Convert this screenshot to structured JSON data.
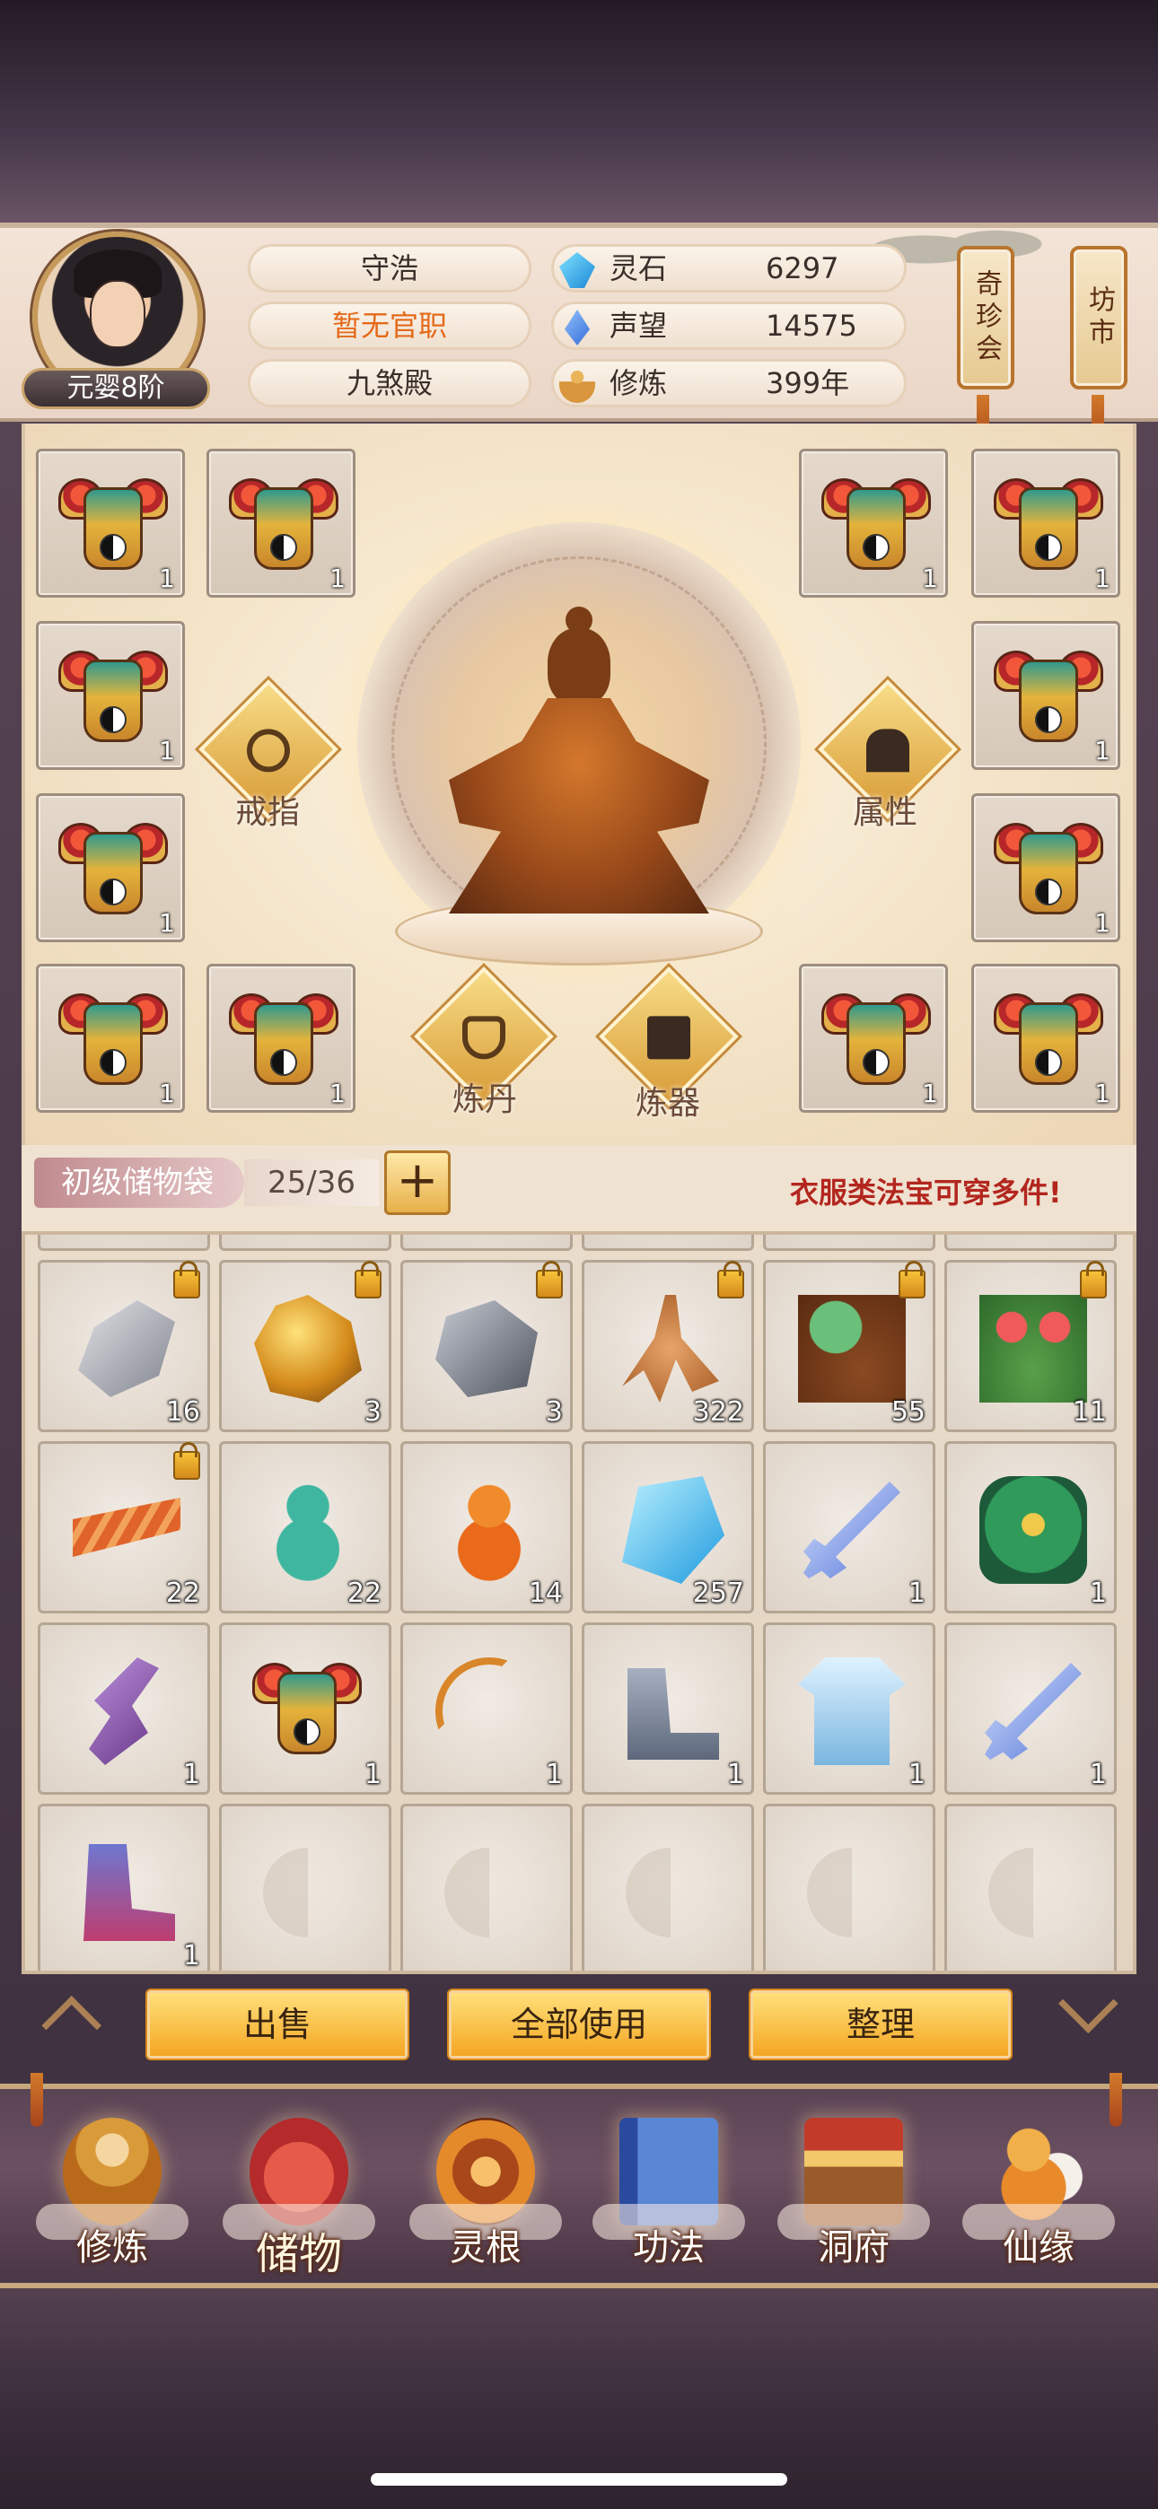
{
  "player": {
    "realm": "元婴8阶",
    "name": "守浩",
    "title": "暂无官职",
    "sect": "九煞殿"
  },
  "stats": [
    {
      "label": "灵石",
      "value": "6297",
      "icon": "spirit-stone-icon"
    },
    {
      "label": "声望",
      "value": "14575",
      "icon": "prestige-icon"
    },
    {
      "label": "修炼",
      "value": "399年",
      "icon": "cultivation-icon"
    }
  ],
  "shops": {
    "treasure": "奇珍会",
    "market": "坊市"
  },
  "equipment": {
    "left_slots": [
      "1",
      "1",
      "1",
      "1",
      "1",
      "1"
    ],
    "right_slots": [
      "1",
      "1",
      "1",
      "1",
      "1",
      "1"
    ],
    "ring_label": "戒指",
    "attr_label": "属性",
    "alchemy_label": "炼丹",
    "forge_label": "炼器"
  },
  "storage": {
    "bag_name": "初级储物袋",
    "capacity": "25/36",
    "expand": "+",
    "tip": "衣服类法宝可穿多件!"
  },
  "inventory": [
    {
      "name": "stone-icon",
      "cls": "it-stone",
      "count": "16",
      "locked": true
    },
    {
      "name": "gold-ore-icon",
      "cls": "it-gold",
      "count": "3",
      "locked": true
    },
    {
      "name": "iron-ore-icon",
      "cls": "it-ore",
      "count": "3",
      "locked": true
    },
    {
      "name": "ginseng-icon",
      "cls": "it-root",
      "count": "322",
      "locked": true
    },
    {
      "name": "herb-root-icon",
      "cls": "it-herb",
      "count": "55",
      "locked": true
    },
    {
      "name": "flower-herb-icon",
      "cls": "it-flower",
      "count": "11",
      "locked": true
    },
    {
      "name": "cordyceps-icon",
      "cls": "it-worm",
      "count": "22",
      "locked": true
    },
    {
      "name": "green-gourd-icon",
      "cls": "it-gourd-g",
      "count": "22",
      "locked": false
    },
    {
      "name": "orange-gourd-icon",
      "cls": "it-gourd-o",
      "count": "14",
      "locked": false
    },
    {
      "name": "spirit-crystal-icon",
      "cls": "it-crystal",
      "count": "257",
      "locked": false
    },
    {
      "name": "blue-sword-icon",
      "cls": "it-sword",
      "count": "1",
      "locked": false
    },
    {
      "name": "green-armor-icon",
      "cls": "it-green-armor",
      "count": "1",
      "locked": false
    },
    {
      "name": "purple-blade-icon",
      "cls": "it-blade",
      "count": "1",
      "locked": false
    },
    {
      "name": "golden-armor-icon",
      "cls": "it-armor",
      "count": "1",
      "locked": false
    },
    {
      "name": "bow-icon",
      "cls": "it-bow",
      "count": "1",
      "locked": false
    },
    {
      "name": "steel-boots-icon",
      "cls": "it-boots",
      "count": "1",
      "locked": false
    },
    {
      "name": "white-robe-icon",
      "cls": "it-robe",
      "count": "1",
      "locked": false
    },
    {
      "name": "blue-sword-icon",
      "cls": "it-sword",
      "count": "1",
      "locked": false
    },
    {
      "name": "cloth-boots-icon",
      "cls": "it-boots2",
      "count": "1",
      "locked": false
    },
    {
      "empty": true
    },
    {
      "empty": true
    },
    {
      "empty": true
    },
    {
      "empty": true
    },
    {
      "empty": true
    }
  ],
  "actions": {
    "sell": "出售",
    "use_all": "全部使用",
    "sort": "整理"
  },
  "nav": [
    {
      "label": "修炼",
      "icon": "cultivate-icon",
      "cls": "ic-monk",
      "active": false
    },
    {
      "label": "储物",
      "icon": "storage-bag-icon",
      "cls": "ic-bag",
      "active": true
    },
    {
      "label": "灵根",
      "icon": "spirit-root-icon",
      "cls": "ic-root",
      "active": false
    },
    {
      "label": "功法",
      "icon": "skill-book-icon",
      "cls": "ic-book",
      "active": false
    },
    {
      "label": "洞府",
      "icon": "cave-house-icon",
      "cls": "ic-house",
      "active": false
    },
    {
      "label": "仙缘",
      "icon": "immortal-fate-icon",
      "cls": "ic-gourd",
      "active": false
    }
  ]
}
